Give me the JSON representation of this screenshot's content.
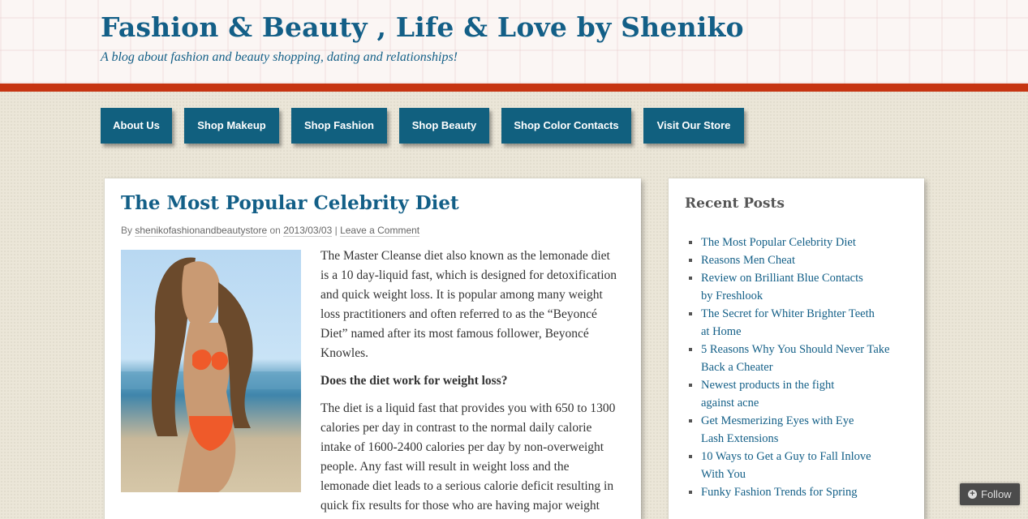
{
  "site": {
    "title": "Fashion & Beauty , Life & Love by Sheniko",
    "description": "A blog about fashion and beauty shopping, dating and relationships!"
  },
  "nav": {
    "items": [
      {
        "label": "About Us"
      },
      {
        "label": "Shop Makeup"
      },
      {
        "label": "Shop Fashion"
      },
      {
        "label": "Shop Beauty"
      },
      {
        "label": "Shop Color Contacts"
      },
      {
        "label": "Visit Our Store"
      }
    ]
  },
  "post": {
    "title": "The Most Popular Celebrity Diet",
    "byline": {
      "by": "By",
      "author": "shenikofashionandbeautystore",
      "on": "on",
      "date": "2013/03/03",
      "sep": "|",
      "comment_link": "Leave a Comment"
    },
    "paragraphs": [
      "The Master Cleanse diet also known as the lemonade diet is a 10 day-liquid fast, which is designed for detoxification and quick weight loss. It is popular among many weight loss practitioners and often referred to as the “Beyoncé Diet” named after its most famous follower, Beyoncé Knowles.",
      "Does the diet work for weight loss?",
      "The diet is a liquid fast that provides you with 650 to 1300 calories per day in contrast to the normal daily calorie intake of 1600-2400 calories per day by non-overweight people. Any fast will result in weight loss and the lemonade diet leads to a serious calorie deficit resulting in quick fix results for those who are having major weight"
    ]
  },
  "sidebar": {
    "widget_title": "Recent Posts",
    "recent_posts": [
      {
        "lines": [
          "The Most Popular Celebrity Diet"
        ]
      },
      {
        "lines": [
          "Reasons Men Cheat"
        ]
      },
      {
        "lines": [
          "Review on Brilliant Blue Contacts",
          "by Freshlook"
        ]
      },
      {
        "lines": [
          "The Secret for Whiter Brighter Teeth",
          "at Home"
        ]
      },
      {
        "lines": [
          "5 Reasons Why You Should Never Take",
          "Back a Cheater"
        ]
      },
      {
        "lines": [
          "Newest products in the fight",
          "against acne"
        ]
      },
      {
        "lines": [
          "Get Mesmerizing Eyes with Eye",
          "Lash Extensions"
        ]
      },
      {
        "lines": [
          "10 Ways to Get a Guy to Fall Inlove",
          "With You"
        ]
      },
      {
        "lines": [
          "Funky Fashion Trends for Spring"
        ]
      }
    ]
  },
  "follow": {
    "label": "Follow",
    "icon": "plus-icon"
  },
  "colors": {
    "accent": "#135f87",
    "nav": "#11607f",
    "stripe": "#c63512"
  }
}
